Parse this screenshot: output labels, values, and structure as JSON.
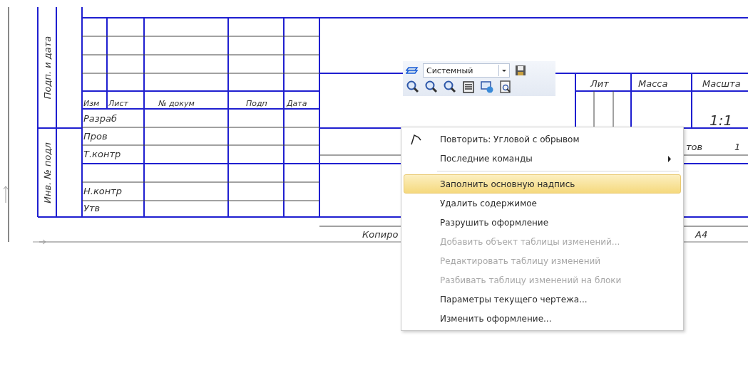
{
  "drawing": {
    "side_labels": [
      "Подп. и дата",
      "Инв. № подл"
    ],
    "change_headers": [
      "Изм",
      "Лист",
      "№ докум",
      "Подп",
      "Дата"
    ],
    "role_labels": [
      "Разраб",
      "Пров",
      "Т.контр",
      "Н.контр",
      "Утв"
    ],
    "title_headers": [
      "Лит",
      "Масса",
      "Масшта"
    ],
    "scale": "1:1",
    "sheets_label": "тов",
    "sheets_count": "1",
    "copied_label": "Копиро",
    "format": "А4"
  },
  "toolbar": {
    "style_field": "Системный"
  },
  "context_menu": {
    "items": [
      {
        "kind": "repeat",
        "label": "Повторить: Угловой с обрывом",
        "disabled": false,
        "selected": false
      },
      {
        "kind": "submenu",
        "label": "Последние команды",
        "disabled": false,
        "selected": false
      },
      {
        "kind": "separator"
      },
      {
        "kind": "command",
        "label": "Заполнить основную надпись",
        "disabled": false,
        "selected": true
      },
      {
        "kind": "command",
        "label": "Удалить содержимое",
        "disabled": false,
        "selected": false
      },
      {
        "kind": "command",
        "label": "Разрушить оформление",
        "disabled": false,
        "selected": false
      },
      {
        "kind": "command",
        "label": "Добавить объект таблицы изменений...",
        "disabled": true,
        "selected": false
      },
      {
        "kind": "command",
        "label": "Редактировать таблицу изменений",
        "disabled": true,
        "selected": false
      },
      {
        "kind": "command",
        "label": "Разбивать таблицу изменений на блоки",
        "disabled": true,
        "selected": false
      },
      {
        "kind": "command",
        "label": "Параметры текущего чертежа...",
        "disabled": false,
        "selected": false
      },
      {
        "kind": "command",
        "label": "Изменить оформление...",
        "disabled": false,
        "selected": false
      }
    ]
  }
}
